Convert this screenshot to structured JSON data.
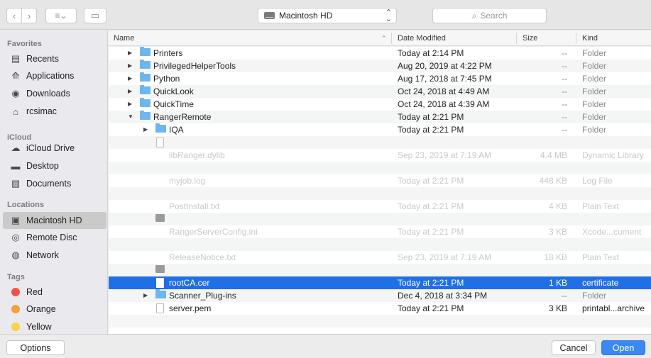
{
  "toolbar": {
    "back_icon": "chevron-left-icon",
    "forward_icon": "chevron-right-icon",
    "view_icon": "list-view-icon",
    "new_folder_icon": "new-folder-icon",
    "location": "Macintosh HD",
    "search_placeholder": "Search"
  },
  "sidebar": {
    "favorites_header": "Favorites",
    "favorites": [
      {
        "label": "Recents",
        "icon": "recents-icon"
      },
      {
        "label": "Applications",
        "icon": "applications-icon"
      },
      {
        "label": "Downloads",
        "icon": "downloads-icon"
      },
      {
        "label": "rcsimac",
        "icon": "home-icon"
      }
    ],
    "icloud_header": "iCloud",
    "icloud": [
      {
        "label": "iCloud Drive",
        "icon": "cloud-icon"
      },
      {
        "label": "Desktop",
        "icon": "desktop-icon"
      },
      {
        "label": "Documents",
        "icon": "documents-icon"
      }
    ],
    "locations_header": "Locations",
    "locations": [
      {
        "label": "Macintosh HD",
        "icon": "hard-drive-icon",
        "active": true
      },
      {
        "label": "Remote Disc",
        "icon": "disc-icon"
      },
      {
        "label": "Network",
        "icon": "network-icon"
      }
    ],
    "tags_header": "Tags",
    "tags": [
      {
        "label": "Red",
        "color": "#f0524a"
      },
      {
        "label": "Orange",
        "color": "#f5a03a"
      },
      {
        "label": "Yellow",
        "color": "#f7d442"
      }
    ]
  },
  "columns": {
    "name": "Name",
    "date": "Date Modified",
    "size": "Size",
    "kind": "Kind"
  },
  "files": [
    {
      "name": "Printers",
      "date": "Today at 2:14 PM",
      "size": "--",
      "kind": "Folder",
      "type": "folder",
      "disclosure": "▶",
      "level": 0
    },
    {
      "name": "PrivilegedHelperTools",
      "date": "Aug 20, 2019 at 4:22 PM",
      "size": "--",
      "kind": "Folder",
      "type": "folder",
      "disclosure": "▶",
      "level": 0
    },
    {
      "name": "Python",
      "date": "Aug 17, 2018 at 7:45 PM",
      "size": "--",
      "kind": "Folder",
      "type": "folder",
      "disclosure": "▶",
      "level": 0
    },
    {
      "name": "QuickLook",
      "date": "Oct 24, 2018 at 4:49 AM",
      "size": "--",
      "kind": "Folder",
      "type": "folder",
      "disclosure": "▶",
      "level": 0
    },
    {
      "name": "QuickTime",
      "date": "Oct 24, 2018 at 4:39 AM",
      "size": "--",
      "kind": "Folder",
      "type": "folder",
      "disclosure": "▶",
      "level": 0
    },
    {
      "name": "RangerRemote",
      "date": "Today at 2:21 PM",
      "size": "--",
      "kind": "Folder",
      "type": "folder",
      "disclosure": "▼",
      "level": 0
    },
    {
      "name": "IQA",
      "date": "Today at 2:21 PM",
      "size": "--",
      "kind": "Folder",
      "type": "folder",
      "disclosure": "▶",
      "level": 1
    },
    {
      "name": "",
      "date": "",
      "size": "",
      "kind": "",
      "type": "doc",
      "dim": true,
      "level": 1
    },
    {
      "name": "libRanger.dylib",
      "date": "Sep 23, 2019 at 7:19 AM",
      "size": "4.4 MB",
      "kind": "Dynamic Library",
      "type": "none",
      "dim": true,
      "level": 1
    },
    {
      "name": "",
      "date": "",
      "size": "",
      "kind": "",
      "type": "none",
      "dim": true,
      "level": 1
    },
    {
      "name": "myjob.log",
      "date": "Today at 2:21 PM",
      "size": "448 KB",
      "kind": "Log File",
      "type": "none",
      "dim": true,
      "level": 1
    },
    {
      "name": "",
      "date": "",
      "size": "",
      "kind": "",
      "type": "none",
      "dim": true,
      "level": 1
    },
    {
      "name": "PostInstall.txt",
      "date": "Today at 2:21 PM",
      "size": "4 KB",
      "kind": "Plain Text",
      "type": "none",
      "dim": true,
      "level": 1
    },
    {
      "name": "",
      "date": "",
      "size": "",
      "kind": "",
      "type": "exec",
      "dim": true,
      "level": 1
    },
    {
      "name": "RangerServerConfig.ini",
      "date": "Today at 2:21 PM",
      "size": "3 KB",
      "kind": "Xcode...cument",
      "type": "none",
      "dim": true,
      "level": 1
    },
    {
      "name": "",
      "date": "",
      "size": "",
      "kind": "",
      "type": "none",
      "dim": true,
      "level": 1
    },
    {
      "name": "ReleaseNotice.txt",
      "date": "Sep 23, 2019 at 7:19 AM",
      "size": "18 KB",
      "kind": "Plain Text",
      "type": "none",
      "dim": true,
      "level": 1
    },
    {
      "name": "",
      "date": "",
      "size": "",
      "kind": "",
      "type": "exec",
      "dim": true,
      "level": 1
    },
    {
      "name": "rootCA.cer",
      "date": "Today at 2:21 PM",
      "size": "1 KB",
      "kind": "certificate",
      "type": "doc",
      "selected": true,
      "level": 1
    },
    {
      "name": "Scanner_Plug-ins",
      "date": "Dec 4, 2018 at 3:34 PM",
      "size": "--",
      "kind": "Folder",
      "type": "folder",
      "disclosure": "▶",
      "level": 1
    },
    {
      "name": "server.pem",
      "date": "Today at 2:21 PM",
      "size": "3 KB",
      "kind": "printabl...archive",
      "type": "doc",
      "level": 1
    },
    {
      "name": "",
      "date": "",
      "size": "",
      "kind": "",
      "type": "none",
      "dim": true,
      "level": 1
    }
  ],
  "footer": {
    "options_label": "Options",
    "cancel_label": "Cancel",
    "open_label": "Open"
  },
  "colors": {
    "selection": "#1f6fe6",
    "primary_button": "#3b88f5",
    "folder": "#6db6ee"
  }
}
